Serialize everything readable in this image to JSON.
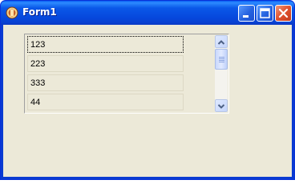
{
  "window": {
    "title": "Form1",
    "colors": {
      "titlebar": "#0a58e8",
      "client": "#ece9d8",
      "close": "#e0512e"
    }
  },
  "listbox": {
    "items": [
      "123",
      "223",
      "333",
      "44"
    ],
    "focused_index": 0
  },
  "icons": {
    "app": "app-icon",
    "minimize": "minimize-icon",
    "maximize": "maximize-icon",
    "close": "close-icon",
    "scroll_up": "chevron-up-icon",
    "scroll_down": "chevron-down-icon"
  }
}
